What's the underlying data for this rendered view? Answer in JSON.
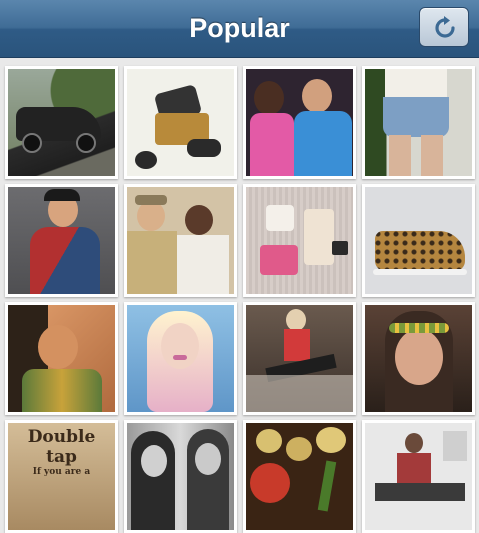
{
  "header": {
    "title": "Popular",
    "refresh_icon": "refresh-icon"
  },
  "grid": {
    "rows": 4,
    "columns": 4,
    "photos": [
      {
        "id": "photo-1",
        "colors": [
          "#7a8a6a",
          "#2c2c2c",
          "#c9a46a"
        ]
      },
      {
        "id": "photo-2",
        "colors": [
          "#f2f2ec",
          "#3a3a3a",
          "#d7a45a"
        ]
      },
      {
        "id": "photo-3",
        "colors": [
          "#3a2a3a",
          "#e35aa6",
          "#3a8fd6"
        ]
      },
      {
        "id": "photo-4",
        "colors": [
          "#cfd6c2",
          "#6d8fb3",
          "#d8b49a"
        ]
      },
      {
        "id": "photo-5",
        "colors": [
          "#6f6f72",
          "#b23030",
          "#2e4c7a"
        ]
      },
      {
        "id": "photo-6",
        "colors": [
          "#c8b79c",
          "#7a6a52",
          "#e9e3d6"
        ]
      },
      {
        "id": "photo-7",
        "colors": [
          "#d7cdc8",
          "#e05a8a",
          "#f4f0ea"
        ]
      },
      {
        "id": "photo-8",
        "colors": [
          "#d7d9dc",
          "#a5773d",
          "#3a2a1a"
        ]
      },
      {
        "id": "photo-9",
        "colors": [
          "#d49160",
          "#2d2218",
          "#5b7a3a"
        ]
      },
      {
        "id": "photo-10",
        "colors": [
          "#6fa5d2",
          "#f1d3c5",
          "#c96a9a"
        ]
      },
      {
        "id": "photo-11",
        "colors": [
          "#4a3f3a",
          "#d23a3a",
          "#cfc7bc"
        ]
      },
      {
        "id": "photo-12",
        "colors": [
          "#3a2a22",
          "#d8a68a",
          "#7a9a3a"
        ]
      },
      {
        "id": "photo-13",
        "colors": [
          "#b89a72",
          "#ffffff",
          "#4a3a2a"
        ],
        "caption": {
          "line1": "Double tap",
          "line2": "If you are a"
        }
      },
      {
        "id": "photo-14",
        "colors": [
          "#8a8a8a",
          "#d9d9d9",
          "#2a2a2a"
        ]
      },
      {
        "id": "photo-15",
        "colors": [
          "#5a3a22",
          "#d8c070",
          "#c83a2a"
        ]
      },
      {
        "id": "photo-16",
        "colors": [
          "#e4e4e4",
          "#a33a3a",
          "#3a3a3a"
        ]
      }
    ]
  }
}
